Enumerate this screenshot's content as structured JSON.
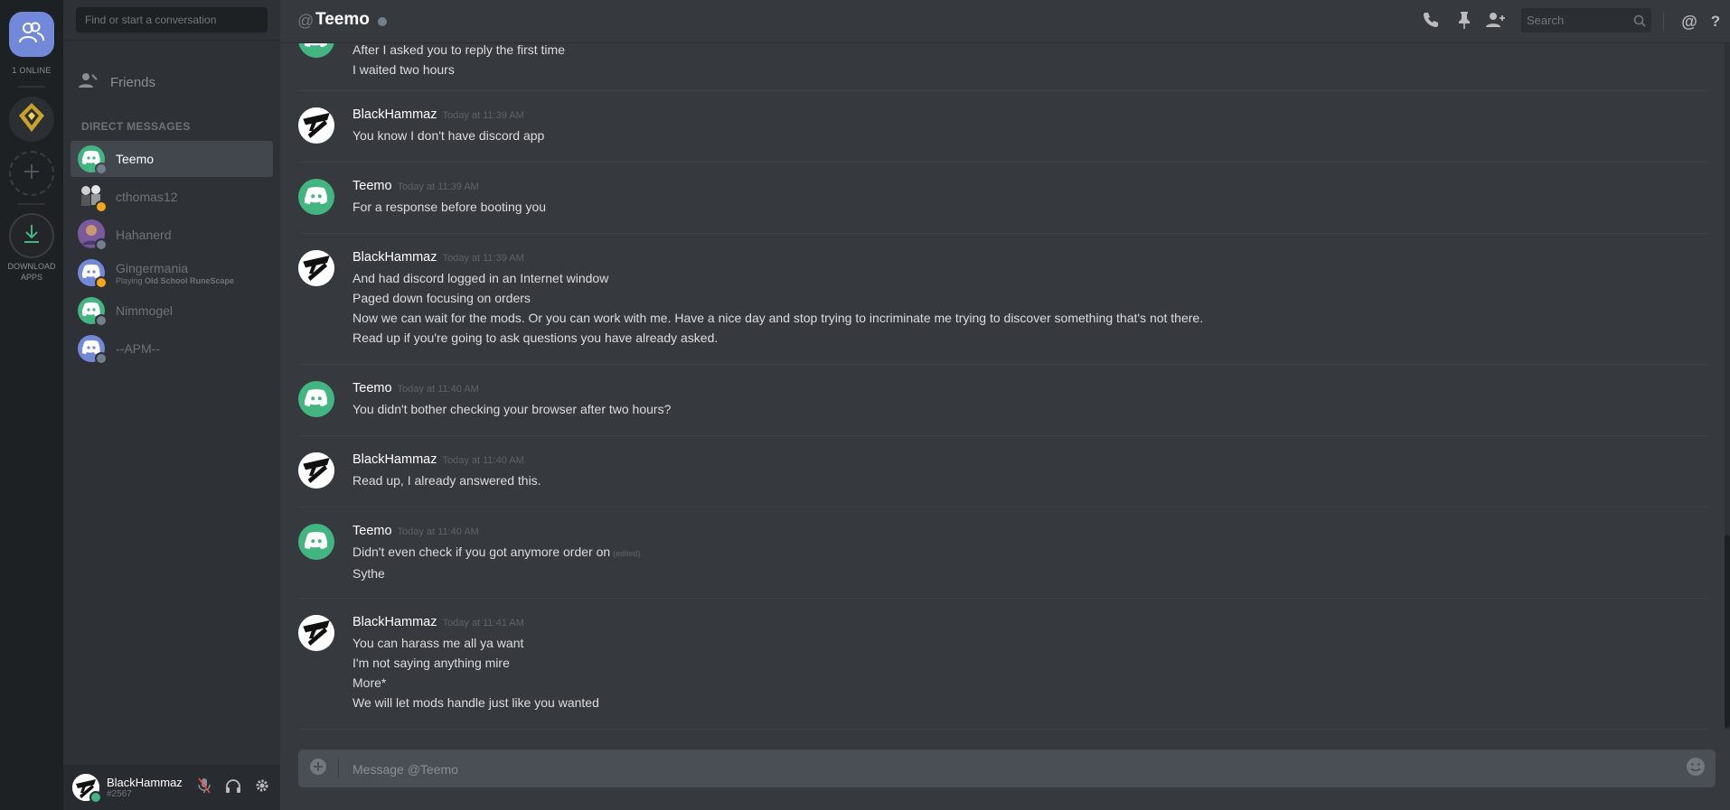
{
  "rail": {
    "online_count": "1 ONLINE",
    "download_label_line1": "DOWNLOAD",
    "download_label_line2": "APPS"
  },
  "sidebar": {
    "search_placeholder": "Find or start a conversation",
    "friends_label": "Friends",
    "dm_header": "DIRECT MESSAGES",
    "dms": [
      {
        "name": "Teemo",
        "status": "offline",
        "avatar": "discord-green",
        "active": true
      },
      {
        "name": "cthomas12",
        "status": "idle",
        "avatar": "photo"
      },
      {
        "name": "Hahanerd",
        "status": "offline",
        "avatar": "photo"
      },
      {
        "name": "Gingermania",
        "status": "idle",
        "avatar": "discord-blurple",
        "activity_prefix": "Playing",
        "activity_game": "Old School RuneScape"
      },
      {
        "name": "Nimmogel",
        "status": "offline",
        "avatar": "discord-green"
      },
      {
        "name": "--APM--",
        "status": "offline",
        "avatar": "discord-blurple"
      }
    ]
  },
  "user_panel": {
    "username": "BlackHammaz",
    "discriminator": "#2567"
  },
  "header": {
    "at": "@",
    "channel": "Teemo",
    "search_placeholder": "Search"
  },
  "messages": [
    {
      "author": "",
      "time": "",
      "lines": [
        "After I asked you to reply the first time",
        "I waited two hours"
      ],
      "avatar": "discord-green"
    },
    {
      "author": "BlackHammaz",
      "time": "Today at 11:39 AM",
      "lines": [
        "You know I don't have discord app"
      ],
      "avatar": "hammaz"
    },
    {
      "author": "Teemo",
      "time": "Today at 11:39 AM",
      "lines": [
        "For a response before booting you"
      ],
      "avatar": "discord-green"
    },
    {
      "author": "BlackHammaz",
      "time": "Today at 11:39 AM",
      "lines": [
        "And had discord logged in an Internet window",
        "Paged down focusing on orders",
        "Now we can wait for the mods. Or you can work with me. Have a nice day and stop trying to incriminate me trying to discover something that's not there.",
        "Read up if you're going to ask questions you have already asked."
      ],
      "avatar": "hammaz"
    },
    {
      "author": "Teemo",
      "time": "Today at 11:40 AM",
      "lines": [
        "You didn't bother checking your browser after two hours?"
      ],
      "avatar": "discord-green"
    },
    {
      "author": "BlackHammaz",
      "time": "Today at 11:40 AM",
      "lines": [
        "Read up, I already answered this."
      ],
      "avatar": "hammaz"
    },
    {
      "author": "Teemo",
      "time": "Today at 11:40 AM",
      "lines": [
        "Didn't even check if you got anymore order on",
        "Sythe"
      ],
      "edited": "(edited)",
      "avatar": "discord-green"
    },
    {
      "author": "BlackHammaz",
      "time": "Today at 11:41 AM",
      "lines": [
        "You can harass me all ya want",
        "I'm not saying anything mire",
        "More*",
        "We will let mods handle just like you wanted"
      ],
      "avatar": "hammaz"
    }
  ],
  "composer": {
    "placeholder": "Message @Teemo"
  },
  "colors": {
    "blurple": "#7289da",
    "online_green": "#43b581",
    "idle_orange": "#faa61a",
    "offline_grey": "#747f8d"
  }
}
